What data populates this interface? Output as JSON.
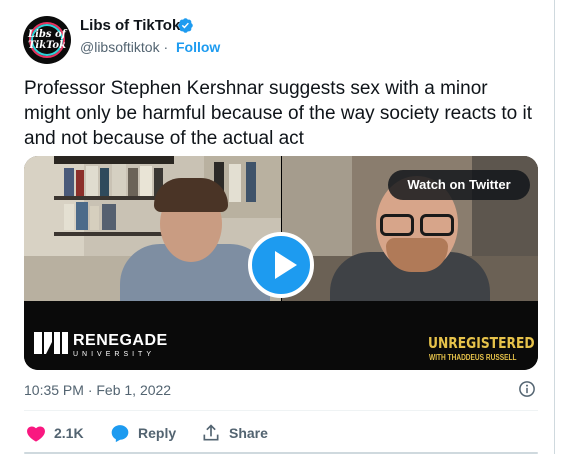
{
  "author": {
    "name": "Libs of TikTok",
    "handle": "@libsoftiktok",
    "separator": "·",
    "follow_label": "Follow",
    "avatar_line1": "Libs of",
    "avatar_line2": "TikTok",
    "verified": true
  },
  "tweet": {
    "text": "Professor Stephen Kershnar suggests sex with a minor might only be harmful because of the way society reacts to it and not because of the actual act",
    "timestamp": "10:35 PM · Feb 1, 2022"
  },
  "media": {
    "watch_label": "Watch on Twitter",
    "left_brand": "RENEGADE",
    "left_brand_sub": "UNIVERSITY",
    "right_brand": "UNREGISTERED",
    "right_brand_sub": "WITH THADDEUS RUSSELL"
  },
  "actions": {
    "like_count": "2.1K",
    "reply_label": "Reply",
    "share_label": "Share"
  },
  "colors": {
    "accent": "#1d9bf0",
    "like": "#f91880",
    "text": "#0f1419",
    "muted": "#536471",
    "brand_gold": "#e6c24a"
  }
}
